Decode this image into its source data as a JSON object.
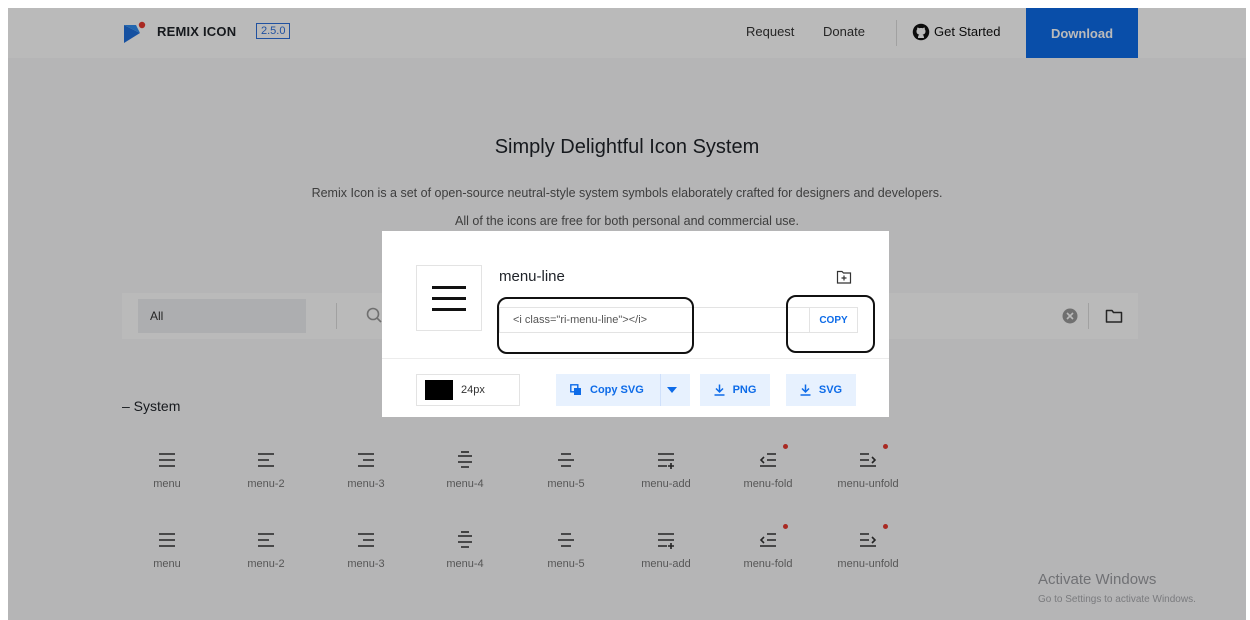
{
  "header": {
    "brand": "REMIX ICON",
    "version": "2.5.0",
    "nav": [
      "Request",
      "Donate"
    ],
    "get_started": "Get Started",
    "download": "Download"
  },
  "hero": {
    "title": "Simply Delightful Icon System",
    "subtitle_line1": "Remix Icon is a set of open-source neutral-style system symbols elaborately crafted for designers and developers.",
    "subtitle_line2": "All of the icons are free for both personal and commercial use."
  },
  "search": {
    "category": "All"
  },
  "section": {
    "title": "– System"
  },
  "icons": {
    "row1": [
      {
        "label": "menu",
        "icon": "menu-icon"
      },
      {
        "label": "menu-2",
        "icon": "menu-2-icon"
      },
      {
        "label": "menu-3",
        "icon": "menu-3-icon"
      },
      {
        "label": "menu-4",
        "icon": "menu-4-icon"
      },
      {
        "label": "menu-5",
        "icon": "menu-5-icon"
      },
      {
        "label": "menu-add",
        "icon": "menu-add-icon"
      },
      {
        "label": "menu-fold",
        "icon": "menu-fold-icon",
        "new": true
      },
      {
        "label": "menu-unfold",
        "icon": "menu-unfold-icon",
        "new": true
      }
    ],
    "row2": [
      {
        "label": "menu",
        "icon": "menu-icon"
      },
      {
        "label": "menu-2",
        "icon": "menu-2-icon"
      },
      {
        "label": "menu-3",
        "icon": "menu-3-icon"
      },
      {
        "label": "menu-4",
        "icon": "menu-4-icon"
      },
      {
        "label": "menu-5",
        "icon": "menu-5-icon"
      },
      {
        "label": "menu-add",
        "icon": "menu-add-icon"
      },
      {
        "label": "menu-fold",
        "icon": "menu-fold-icon",
        "new": true
      },
      {
        "label": "menu-unfold",
        "icon": "menu-unfold-icon",
        "new": true
      }
    ]
  },
  "modal": {
    "icon_name": "menu-line",
    "code": "<i class=\"ri-menu-line\"></i>",
    "copy_label": "COPY",
    "color": "#000000",
    "size": "24px",
    "copy_svg_label": "Copy SVG",
    "png_label": "PNG",
    "svg_label": "SVG"
  },
  "watermark": {
    "title": "Activate Windows",
    "subtitle": "Go to Settings to activate Windows."
  },
  "colors": {
    "accent": "#0d6be8",
    "new_dot": "#e8392f"
  }
}
